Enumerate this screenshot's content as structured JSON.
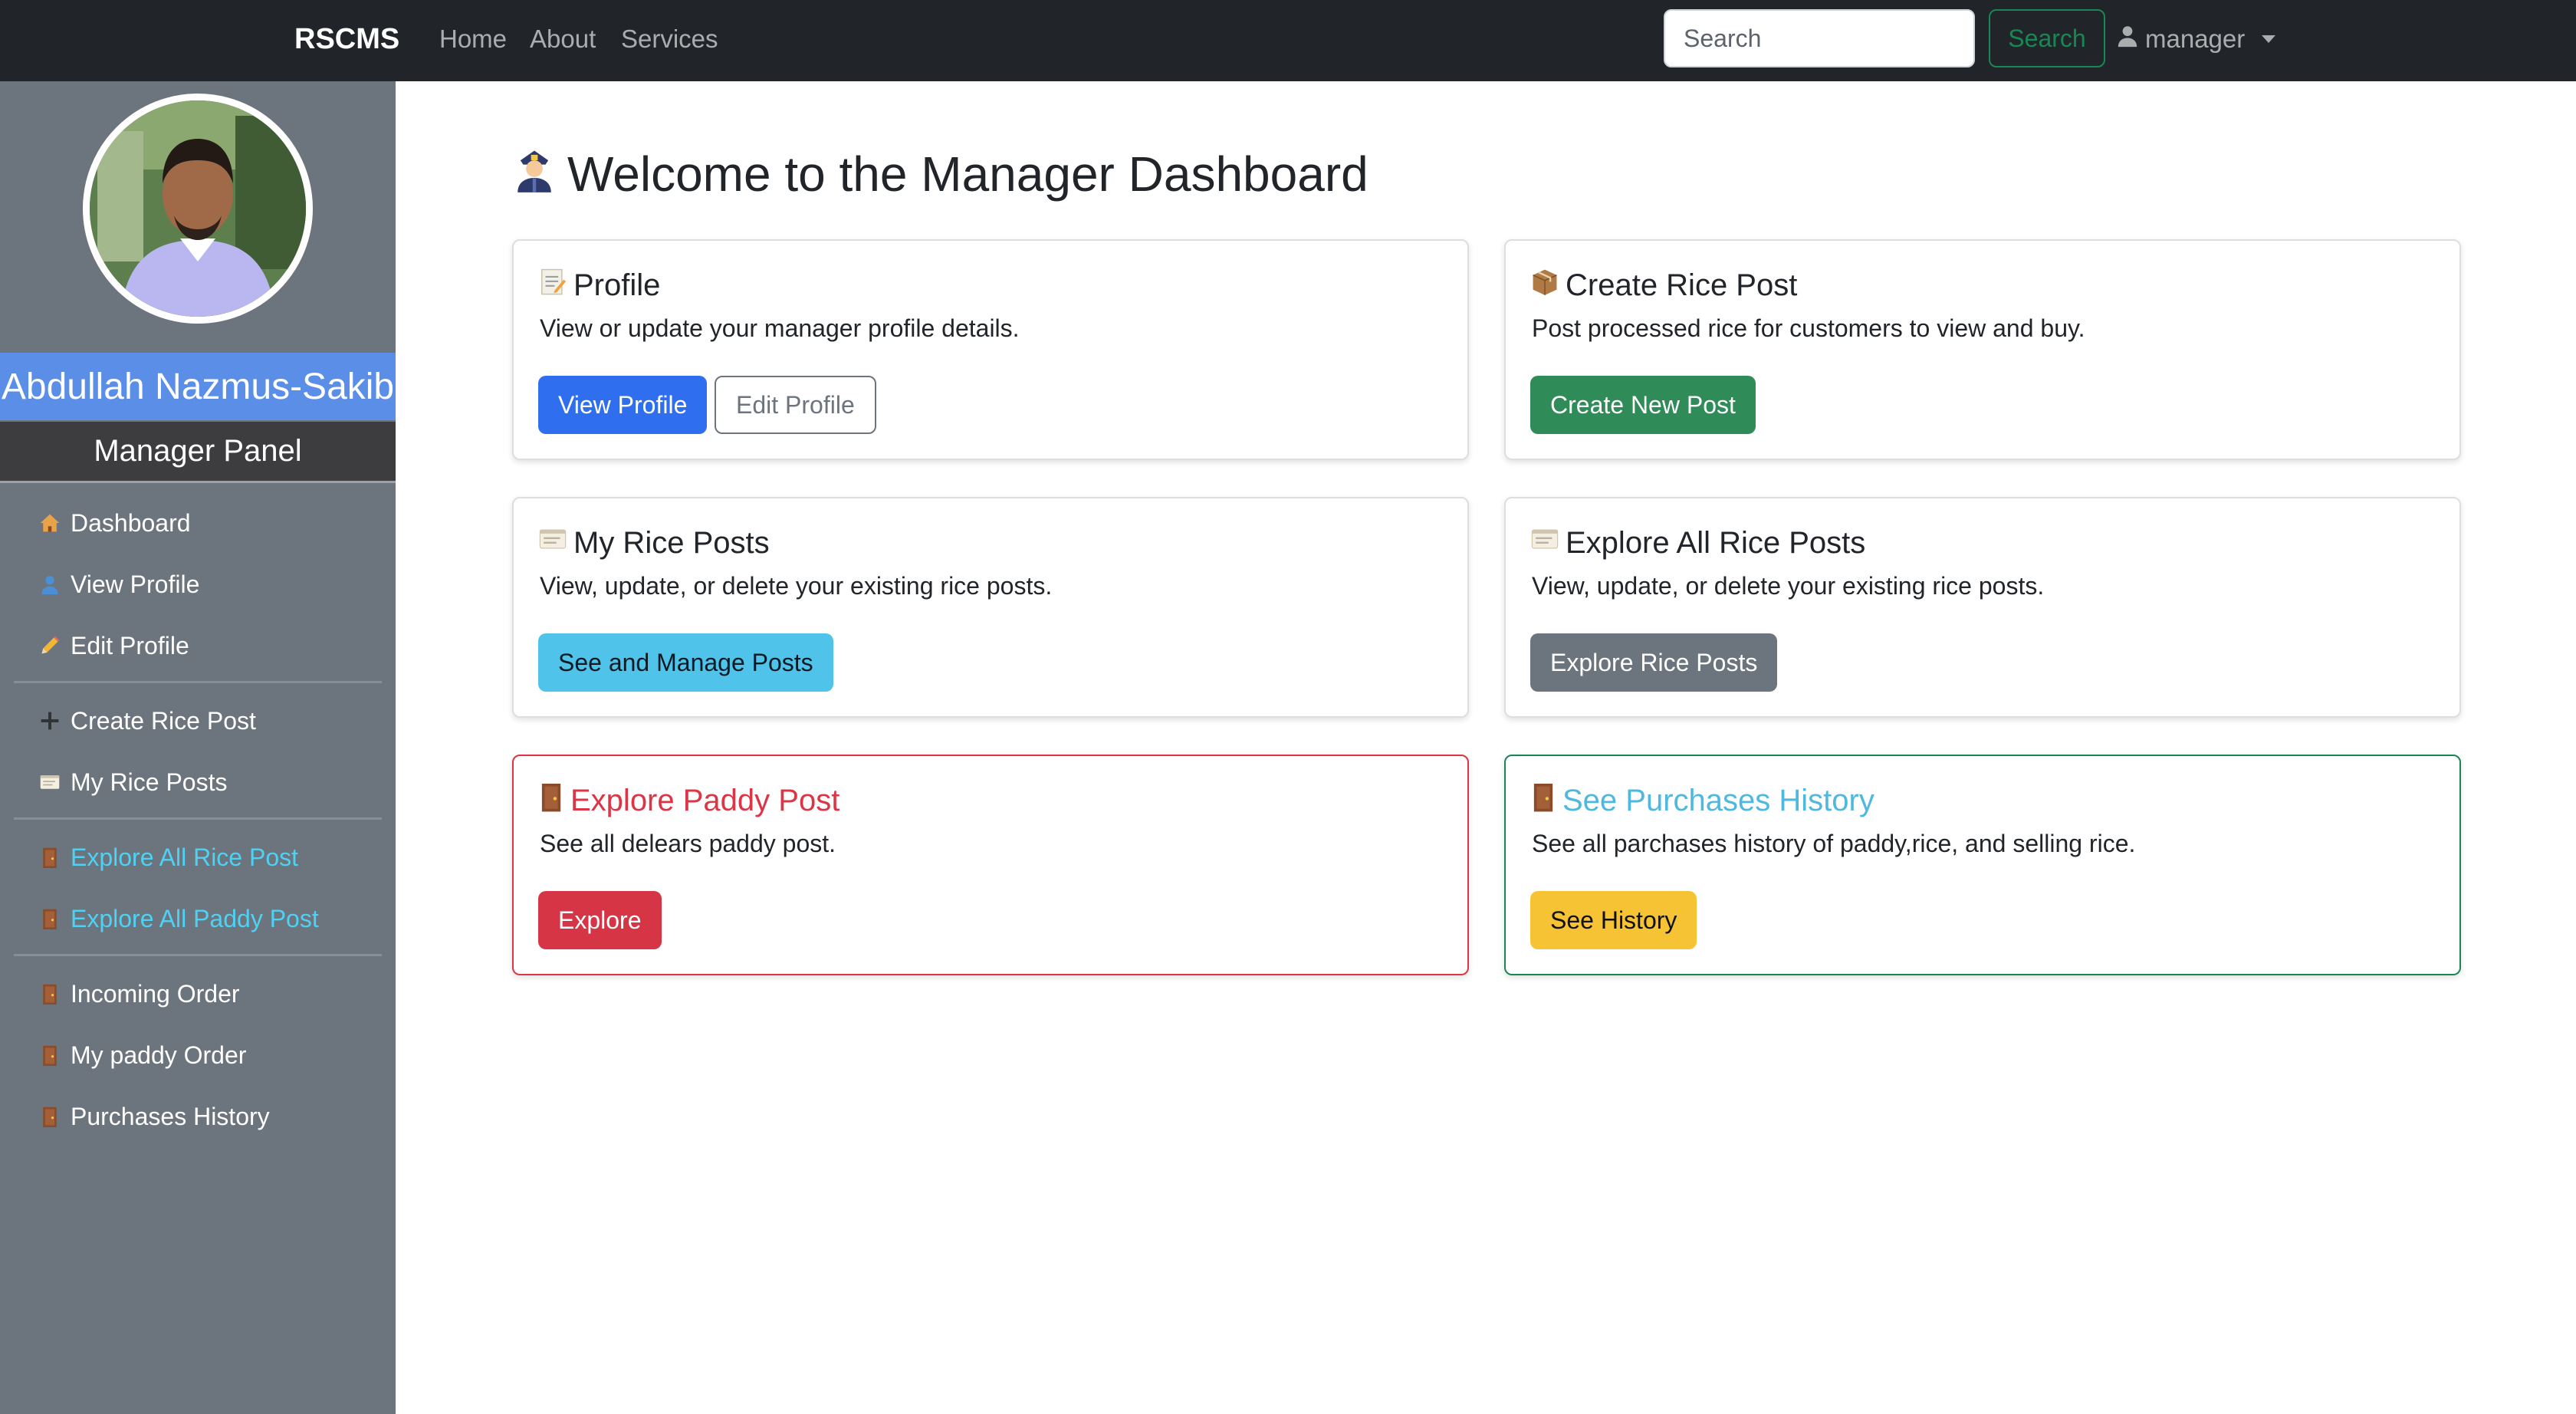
{
  "navbar": {
    "brand": "RSCMS",
    "links": [
      "Home",
      "About",
      "Services"
    ],
    "search_placeholder": "Search",
    "search_button": "Search",
    "user_label": "manager"
  },
  "sidebar": {
    "owner_name": "Abdullah Nazmus-Sakib",
    "panel_title": "Manager Panel",
    "items": [
      {
        "label": "Dashboard",
        "icon": "house-icon"
      },
      {
        "label": "View Profile",
        "icon": "person-icon"
      },
      {
        "label": "Edit Profile",
        "icon": "pencil-icon"
      },
      {
        "label": "Create Rice Post",
        "icon": "plus-icon"
      },
      {
        "label": "My Rice Posts",
        "icon": "scroll-icon"
      },
      {
        "label": "Explore All Rice Post",
        "icon": "door-icon"
      },
      {
        "label": "Explore All Paddy Post",
        "icon": "door-icon"
      },
      {
        "label": "Incoming Order",
        "icon": "door-icon"
      },
      {
        "label": "My paddy Order",
        "icon": "door-icon"
      },
      {
        "label": "Purchases History",
        "icon": "door-icon"
      }
    ],
    "colors": {
      "background": "#6c757d",
      "name_bar": "#5b8ee6",
      "panel_bar": "#3d3d40",
      "link_highlight": "#4fd1f4"
    }
  },
  "main": {
    "title": "Welcome to the Manager Dashboard",
    "title_icon": "police-officer-icon",
    "cards": [
      {
        "title": "Profile",
        "icon": "memo-icon",
        "text": "View or update your manager profile details.",
        "buttons": [
          "View Profile",
          "Edit Profile"
        ]
      },
      {
        "title": "Create Rice Post",
        "icon": "package-icon",
        "text": "Post processed rice for customers to view and buy.",
        "buttons": [
          "Create New Post"
        ]
      },
      {
        "title": "My Rice Posts",
        "icon": "scroll-icon",
        "text": "View, update, or delete your existing rice posts.",
        "buttons": [
          "See and Manage Posts"
        ]
      },
      {
        "title": "Explore All Rice Posts",
        "icon": "scroll-icon",
        "text": "View, update, or delete your existing rice posts.",
        "buttons": [
          "Explore Rice Posts"
        ]
      },
      {
        "title": "Explore Paddy Post",
        "icon": "door-icon",
        "text": "See all delears paddy post.",
        "buttons": [
          "Explore"
        ]
      },
      {
        "title": "See Purchases History",
        "icon": "door-icon",
        "text": "See all parchases history of paddy,rice, and selling rice.",
        "buttons": [
          "See History"
        ]
      }
    ]
  }
}
